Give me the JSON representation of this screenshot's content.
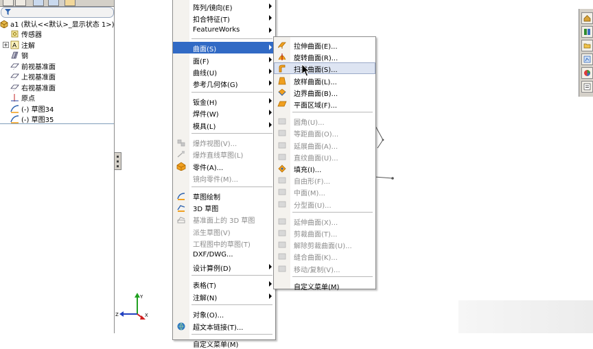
{
  "feature_tree": {
    "tab_count": 5,
    "part_name": "a1 (默认<<默认>_显示状态 1>)",
    "items": [
      {
        "label": "传感器",
        "icon": "sensor-icon"
      },
      {
        "label": "注解",
        "icon": "annotation-icon",
        "expandable": true
      },
      {
        "label": "钢",
        "icon": "material-icon"
      },
      {
        "label": "前视基准面",
        "icon": "plane-icon"
      },
      {
        "label": "上视基准面",
        "icon": "plane-icon"
      },
      {
        "label": "右视基准面",
        "icon": "plane-icon"
      },
      {
        "label": "原点",
        "icon": "origin-icon"
      },
      {
        "label": "(-) 草图34",
        "icon": "sketch-icon"
      },
      {
        "label": "(-) 草图35",
        "icon": "sketch-icon"
      }
    ]
  },
  "main_menu": {
    "items": [
      {
        "label": "阵列/镜向(E)",
        "submenu": true
      },
      {
        "label": "扣合特征(T)",
        "submenu": true
      },
      {
        "label": "FeatureWorks",
        "submenu": true
      },
      {
        "sep": true
      },
      {
        "label": "曲面(S)",
        "submenu": true,
        "highlighted": true
      },
      {
        "label": "面(F)",
        "submenu": true
      },
      {
        "label": "曲线(U)",
        "submenu": true
      },
      {
        "label": "参考几何体(G)",
        "submenu": true
      },
      {
        "sep": true
      },
      {
        "label": "钣金(H)",
        "submenu": true
      },
      {
        "label": "焊件(W)",
        "submenu": true
      },
      {
        "label": "模具(L)",
        "submenu": true
      },
      {
        "sep": true
      },
      {
        "label": "爆炸视图(V)...",
        "disabled": true,
        "icon": "explode-view-icon"
      },
      {
        "label": "爆炸直线草图(L)",
        "disabled": true,
        "icon": "explode-line-icon"
      },
      {
        "label": "零件(A)...",
        "icon": "part-icon"
      },
      {
        "label": "镜向零件(M)...",
        "disabled": true
      },
      {
        "sep": true
      },
      {
        "label": "草图绘制",
        "icon": "sketch-draw-icon"
      },
      {
        "label": "3D 草图",
        "icon": "sketch-3d-icon"
      },
      {
        "label": "基准面上的 3D 草图",
        "disabled": true,
        "icon": "sketch-3d-plane-icon"
      },
      {
        "label": "派生草图(V)",
        "disabled": true
      },
      {
        "label": "工程图中的草图(T)",
        "disabled": true
      },
      {
        "label": "DXF/DWG...",
        "disabled": false
      },
      {
        "label": "设计算例(D)",
        "submenu": true
      },
      {
        "sep": true
      },
      {
        "label": "表格(T)",
        "submenu": true
      },
      {
        "label": "注解(N)",
        "submenu": true
      },
      {
        "sep": true
      },
      {
        "label": "对象(O)...",
        "icon": ""
      },
      {
        "label": "超文本链接(T)...",
        "icon": "hyperlink-icon"
      },
      {
        "sep": true
      },
      {
        "label": "自定义菜单(M)"
      }
    ]
  },
  "submenu": {
    "items": [
      {
        "label": "拉伸曲面(E)...",
        "icon": "extrude-surface-icon"
      },
      {
        "label": "旋转曲面(R)...",
        "icon": "revolve-surface-icon"
      },
      {
        "label": "扫描曲面(S)...",
        "icon": "sweep-surface-icon",
        "hover": true
      },
      {
        "label": "放样曲面(L)...",
        "icon": "loft-surface-icon"
      },
      {
        "label": "边界曲面(B)...",
        "icon": "boundary-surface-icon"
      },
      {
        "label": "平面区域(F)...",
        "icon": "planar-surface-icon"
      },
      {
        "sep": true
      },
      {
        "label": "圆角(U)...",
        "disabled": true,
        "icon": "fillet-icon"
      },
      {
        "label": "等距曲面(O)...",
        "disabled": true,
        "icon": "offset-surface-icon"
      },
      {
        "label": "延展曲面(A)...",
        "disabled": true,
        "icon": "radiate-surface-icon"
      },
      {
        "label": "直纹曲面(U)...",
        "disabled": true,
        "icon": "ruled-surface-icon"
      },
      {
        "label": "填充(I)...",
        "icon": "fill-surface-icon"
      },
      {
        "label": "自由形(F)...",
        "disabled": true,
        "icon": "freeform-icon"
      },
      {
        "label": "中面(M)...",
        "disabled": true,
        "icon": "midsurface-icon"
      },
      {
        "label": "分型面(U)...",
        "disabled": true,
        "icon": "parting-surface-icon"
      },
      {
        "sep": true
      },
      {
        "label": "延伸曲面(X)...",
        "disabled": true,
        "icon": "extend-surface-icon"
      },
      {
        "label": "剪裁曲面(T)...",
        "disabled": true,
        "icon": "trim-surface-icon"
      },
      {
        "label": "解除剪裁曲面(U)...",
        "disabled": true,
        "icon": "untrim-surface-icon"
      },
      {
        "label": "缝合曲面(K)...",
        "disabled": true,
        "icon": "knit-surface-icon"
      },
      {
        "label": "移动/复制(V)...",
        "disabled": true,
        "icon": "move-copy-icon"
      },
      {
        "sep": true
      },
      {
        "label": "自定义菜单(M)"
      }
    ]
  },
  "colors": {
    "highlight": "#316ac5",
    "disabled_text": "#8d8d8d",
    "icon_orange": "#f0a020"
  },
  "axes": {
    "x": "X",
    "y": "Y",
    "z": "Z"
  }
}
